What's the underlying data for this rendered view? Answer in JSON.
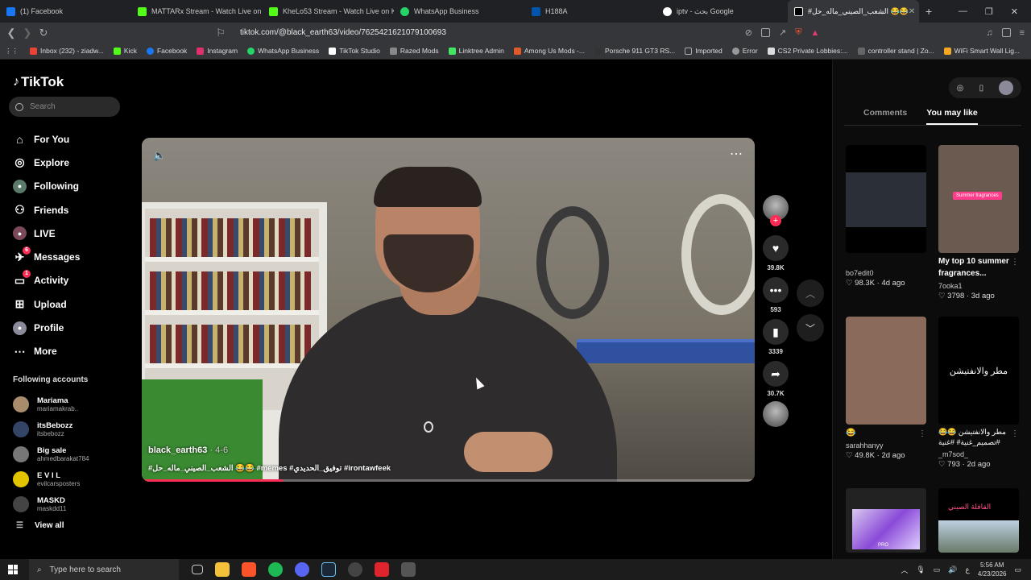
{
  "browser": {
    "tabs": [
      {
        "label": "(1) Facebook",
        "color": "#1877f2"
      },
      {
        "label": "MATTARx Stream - Watch Live on Kick",
        "color": "#53fc18"
      },
      {
        "label": "KheLo53 Stream - Watch Live on Kick",
        "color": "#53fc18"
      },
      {
        "label": "WhatsApp Business",
        "color": "#25d366"
      },
      {
        "label": "H188A",
        "color": "#0055aa"
      },
      {
        "label": "iptv - بحث Google",
        "color": "#ffffff"
      },
      {
        "label": "#الشعب_الصيني_ماله_حل 😂😂",
        "color": "#000000"
      }
    ],
    "url": "tiktok.com/@black_earth63/video/7625421621079100693",
    "bookmarks": [
      {
        "label": "Inbox (232) - ziadw...",
        "color": "#ea4335"
      },
      {
        "label": "Kick",
        "color": "#53fc18"
      },
      {
        "label": "Facebook",
        "color": "#1877f2"
      },
      {
        "label": "Instagram",
        "color": "#e1306c"
      },
      {
        "label": "WhatsApp Business",
        "color": "#25d366"
      },
      {
        "label": "TikTok Studio",
        "color": "#ffffff"
      },
      {
        "label": "Razed Mods",
        "color": "#888888"
      },
      {
        "label": "Linktree Admin",
        "color": "#43e660"
      },
      {
        "label": "Among Us Mods -...",
        "color": "#e05a2a"
      },
      {
        "label": "Porsche 911 GT3 RS...",
        "color": "#333333"
      },
      {
        "label": "Imported",
        "color": "#aaaaaa"
      },
      {
        "label": "Error",
        "color": "#999999"
      },
      {
        "label": "CS2 Private Lobbies:...",
        "color": "#dddddd"
      },
      {
        "label": "controller stand | Zo...",
        "color": "#666666"
      },
      {
        "label": "WiFi Smart Wall Lig...",
        "color": "#f5a623"
      }
    ]
  },
  "tiktok": {
    "logo": "TikTok",
    "search_placeholder": "Search",
    "nav": [
      {
        "label": "For You",
        "icon": "home-icon",
        "badge": ""
      },
      {
        "label": "Explore",
        "icon": "compass-icon",
        "badge": ""
      },
      {
        "label": "Following",
        "icon": "following-icon",
        "badge": ""
      },
      {
        "label": "Friends",
        "icon": "friends-icon",
        "badge": ""
      },
      {
        "label": "LIVE",
        "icon": "live-icon",
        "badge": ""
      },
      {
        "label": "Messages",
        "icon": "messages-icon",
        "badge": "6"
      },
      {
        "label": "Activity",
        "icon": "activity-icon",
        "badge": "1"
      },
      {
        "label": "Upload",
        "icon": "upload-icon",
        "badge": ""
      },
      {
        "label": "Profile",
        "icon": "profile-icon",
        "badge": ""
      },
      {
        "label": "More",
        "icon": "more-icon",
        "badge": ""
      }
    ],
    "following_title": "Following accounts",
    "following": [
      {
        "name": "Mariama",
        "handle": "mariamakrab..",
        "color": "#a88c6c"
      },
      {
        "name": "itsBebozz",
        "handle": "itsbebozz",
        "color": "#334466"
      },
      {
        "name": "Big sale",
        "handle": "ahmedbarakat784",
        "color": "#777777"
      },
      {
        "name": "E V I L",
        "handle": "evilcarsposters",
        "color": "#e2c300"
      },
      {
        "name": "MASKD",
        "handle": "maskdd11",
        "color": "#444444"
      }
    ],
    "view_all": "View all"
  },
  "video": {
    "author": "black_earth63",
    "date": " · 4-6",
    "caption": "#الشعب_الصيني_ماله_حل 😂😂 #memes #توفيق_الحديدي #irontawfeek",
    "progress": 0.23
  },
  "actions": {
    "likes": "39.8K",
    "comments": "593",
    "saves": "3339",
    "shares": "30.7K"
  },
  "right_panel": {
    "tabs": [
      "Comments",
      "You may like"
    ],
    "active_tab": "You may like",
    "cards": [
      {
        "caption": "",
        "user": "bo7edit0",
        "views": "98.3K",
        "age": "4d ago",
        "thumb_color": "#2a2f38"
      },
      {
        "caption": "My top 10 summer fragrances...",
        "user": "7ooka1",
        "views": "3798",
        "age": "3d ago",
        "thumb_color": "#6a5a50",
        "overlay": "Summer fragrances"
      },
      {
        "caption": "😂",
        "user": "sarahhanyy",
        "views": "49.8K",
        "age": "2d ago",
        "thumb_color": "#8a6a5a"
      },
      {
        "caption": "مطر والانفتيشن 😂😂 #تصميم_غنية# #غنية",
        "user": "_m7sod_",
        "views": "793",
        "age": "2d ago",
        "thumb_color": "#000000",
        "overlay": "مطر والانفتيشن"
      },
      {
        "caption": "",
        "user": "",
        "views": "",
        "age": "",
        "thumb_color": "#d8d8e0",
        "overlay": "PRO"
      },
      {
        "caption": "",
        "user": "",
        "views": "",
        "age": "",
        "thumb_color": "#8aa0b8",
        "overlay": "القافلة الصيني"
      }
    ]
  },
  "taskbar": {
    "search_placeholder": "Type here to search",
    "time": "5:56 AM",
    "date": "4/23/2026",
    "lang": "ع"
  }
}
